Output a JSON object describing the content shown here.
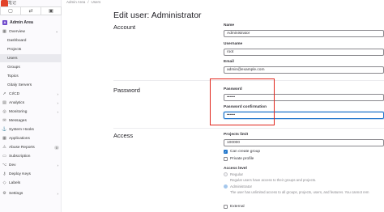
{
  "app": {
    "logo_text": "笔记"
  },
  "breadcrumb": [
    "Admin Area",
    "Users"
  ],
  "sidebar": {
    "admin_area": "Admin Area",
    "items": [
      {
        "label": "Overview",
        "chevron": "⌄"
      },
      {
        "label": "Dashboard"
      },
      {
        "label": "Projects"
      },
      {
        "label": "Users"
      },
      {
        "label": "Groups"
      },
      {
        "label": "Topics"
      },
      {
        "label": "Gitaly Servers"
      },
      {
        "label": "CI/CD",
        "chevron": "›"
      },
      {
        "label": "Analytics",
        "chevron": "›"
      },
      {
        "label": "Monitoring",
        "chevron": "›"
      },
      {
        "label": "Messages"
      },
      {
        "label": "System Hooks"
      },
      {
        "label": "Applications"
      },
      {
        "label": "Abuse Reports",
        "count": "0"
      },
      {
        "label": "Subscription"
      },
      {
        "label": "Dev",
        "chevron": "›"
      },
      {
        "label": "Deploy Keys"
      },
      {
        "label": "Labels"
      },
      {
        "label": "Settings",
        "chevron": "›"
      }
    ]
  },
  "page": {
    "title": "Edit user: Administrator"
  },
  "account": {
    "title": "Account",
    "name_label": "Name",
    "name_value": "Administrator",
    "username_label": "Username",
    "username_value": "root",
    "email_label": "Email",
    "email_value": "admin@example.com"
  },
  "password": {
    "title": "Password",
    "password_label": "Password",
    "password_value": "••••••",
    "confirm_label": "Password confirmation",
    "confirm_value": "••••••"
  },
  "access": {
    "title": "Access",
    "projects_limit_label": "Projects limit",
    "projects_limit_value": "100000",
    "can_create_group": "Can create group",
    "private_profile": "Private profile",
    "access_level_label": "Access level",
    "regular_label": "Regular",
    "regular_help": "Regular users have access to their groups and projects.",
    "admin_label": "Administrator",
    "admin_help": "The user has unlimited access to all groups, projects, users, and features. You cannot rem",
    "external_label": "External"
  },
  "colors": {
    "accent": "#1f75cb",
    "highlight": "#e1261c"
  }
}
